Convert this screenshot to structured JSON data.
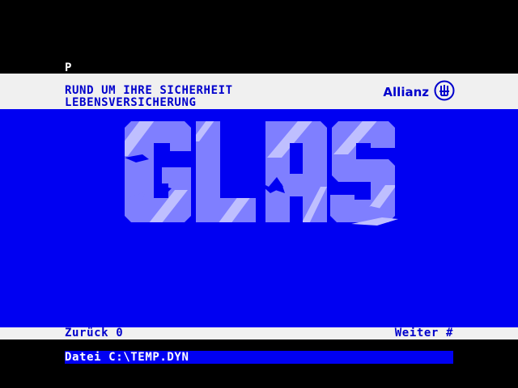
{
  "status": {
    "indicator": "P"
  },
  "header": {
    "line1": "RUND UM IHRE SICHERHEIT",
    "line2": "LEBENSVERSICHERUNG",
    "brand": "Allianz",
    "brand_icon": "allianz-eagle-icon"
  },
  "main": {
    "title_graphic": "GLAS"
  },
  "footer": {
    "back_label": "Zurück 0",
    "next_label": "Weiter #"
  },
  "file_bar": {
    "label": "Datei C:\\TEMP.DYN"
  },
  "colors": {
    "background": "#000000",
    "band": "#f0f0f0",
    "blue": "#0000f2",
    "text_blue": "#0000cc",
    "glass_light": "#7f7fff",
    "glass_highlight": "#bfbfff"
  }
}
